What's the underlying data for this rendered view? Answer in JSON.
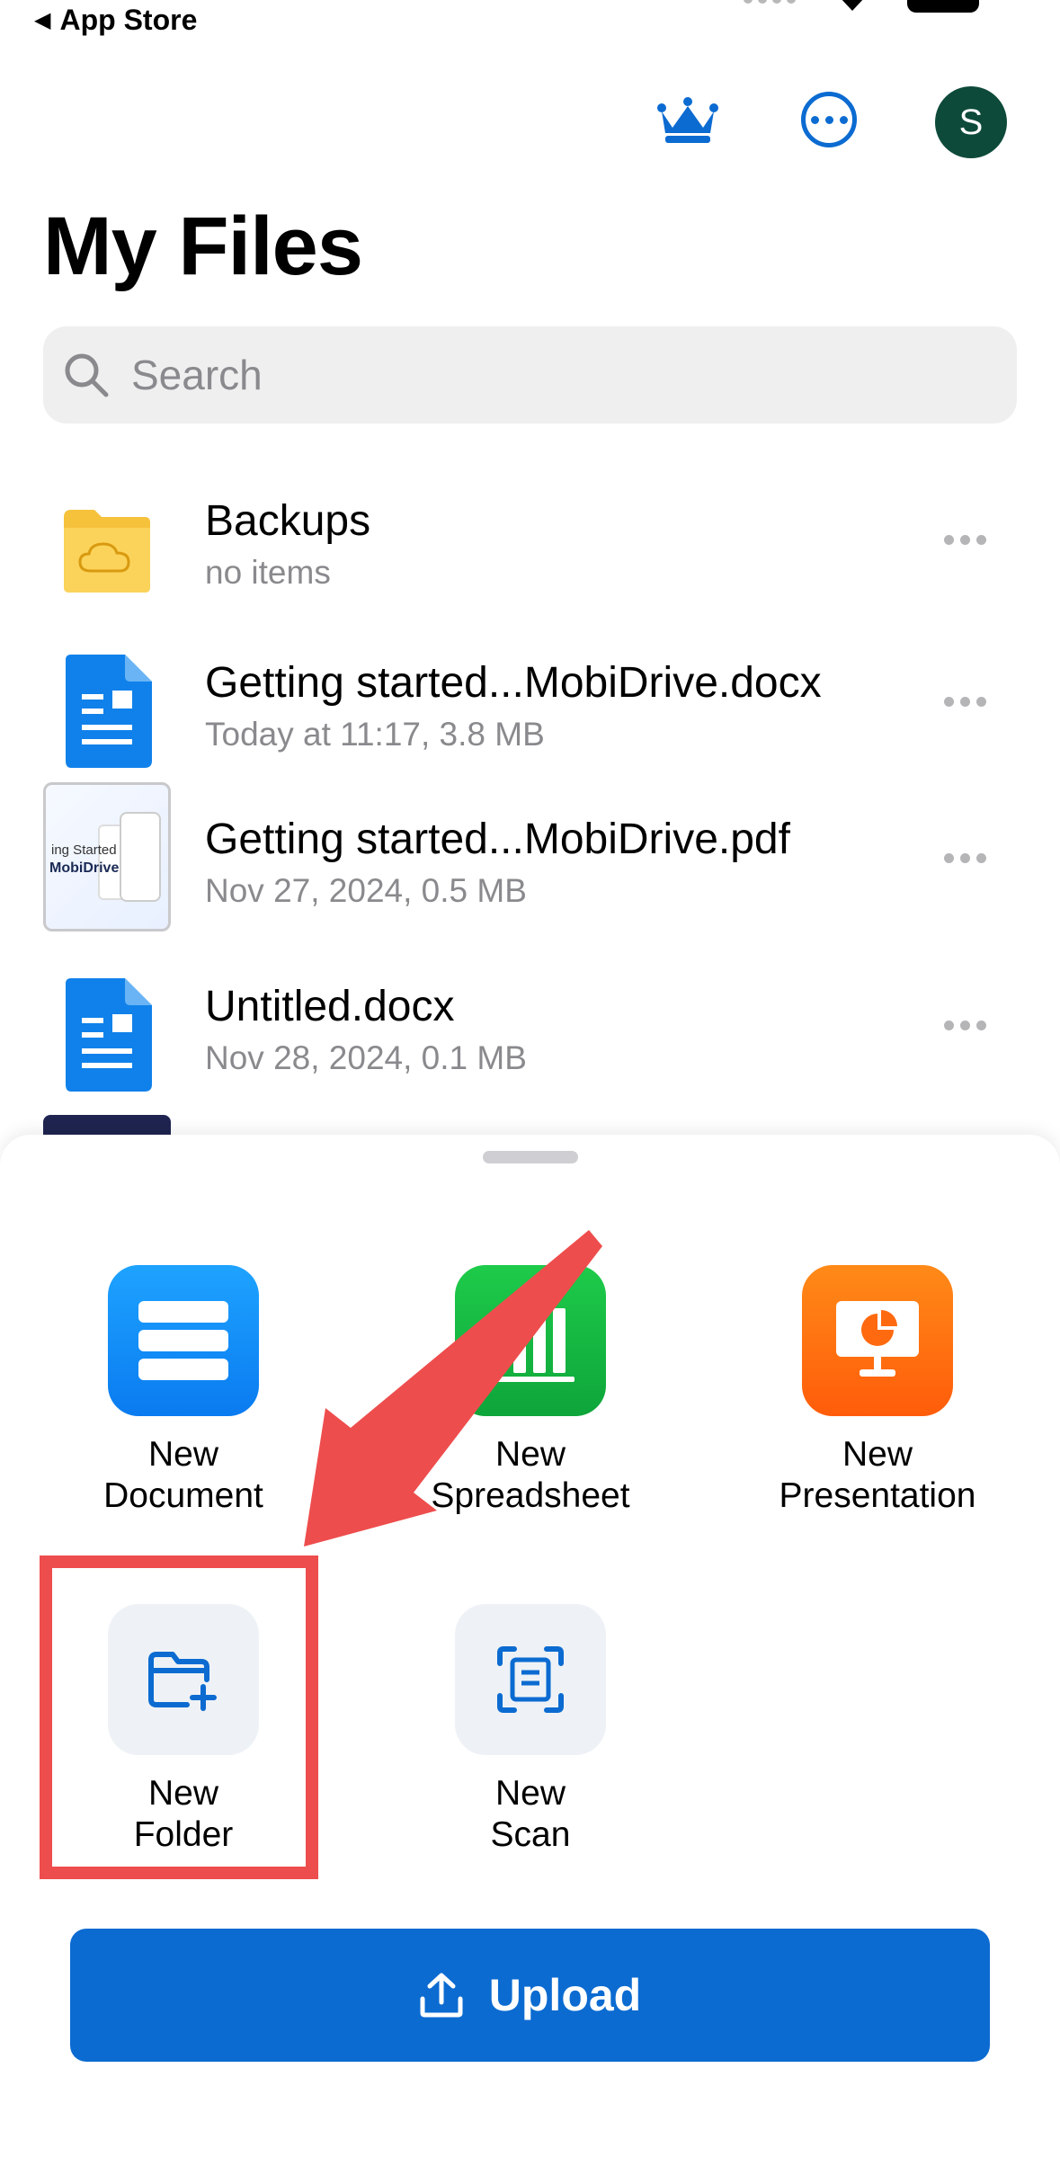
{
  "status_bar": {
    "back_app": "App Store"
  },
  "header": {
    "title": "My Files",
    "avatar_initial": "S",
    "icons": [
      "crown-icon",
      "more-icon"
    ]
  },
  "search": {
    "placeholder": "Search"
  },
  "files": [
    {
      "name": "Backups",
      "meta": "no items",
      "type": "folder"
    },
    {
      "name": "Getting started...MobiDrive.docx",
      "meta": "Today at 11:17, 3.8 MB",
      "type": "docx"
    },
    {
      "name": "Getting started...MobiDrive.pdf",
      "meta": "Nov 27, 2024, 0.5 MB",
      "type": "pdf",
      "thumb_text_1": "ing Started",
      "thumb_text_2": "MobiDrive"
    },
    {
      "name": "Untitled.docx",
      "meta": "Nov 28, 2024, 0.1 MB",
      "type": "docx"
    }
  ],
  "sheet": {
    "actions": [
      {
        "line1": "New",
        "line2": "Document"
      },
      {
        "line1": "New",
        "line2": "Spreadsheet"
      },
      {
        "line1": "New",
        "line2": "Presentation"
      },
      {
        "line1": "New",
        "line2": "Folder"
      },
      {
        "line1": "New",
        "line2": "Scan"
      }
    ],
    "upload_label": "Upload"
  },
  "colors": {
    "accent": "#0b6bd1",
    "annotation": "#ee4d4d",
    "avatar_bg": "#0d4a3a"
  }
}
